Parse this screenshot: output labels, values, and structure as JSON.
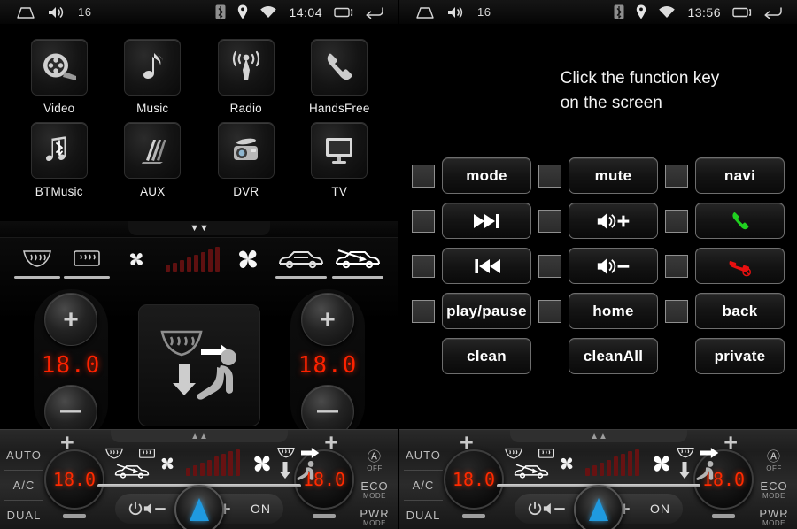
{
  "left": {
    "statusbar": {
      "home_icon": "home-icon",
      "volume_icon": "volume-icon",
      "volume_value": "16",
      "bluetooth_icon": "bluetooth-icon",
      "location_icon": "location-pin-icon",
      "wifi_icon": "wifi-icon",
      "time": "14:04",
      "recents_icon": "recents-icon",
      "back_icon": "back-arrow-icon"
    },
    "apps": [
      {
        "label": "Video",
        "icon": "film-reel-icon"
      },
      {
        "label": "Music",
        "icon": "music-note-icon"
      },
      {
        "label": "Radio",
        "icon": "radio-antenna-icon"
      },
      {
        "label": "HandsFree",
        "icon": "phone-handset-icon"
      },
      {
        "label": "BTMusic",
        "icon": "bluetooth-music-icon"
      },
      {
        "label": "AUX",
        "icon": "aux-lines-icon"
      },
      {
        "label": "DVR",
        "icon": "dashcam-icon"
      },
      {
        "label": "TV",
        "icon": "tv-monitor-icon"
      }
    ],
    "pull_tab_icon": "chevron-down-icon",
    "climate": {
      "top_icons": [
        {
          "name": "front-defrost-icon",
          "underline": true
        },
        {
          "name": "rear-defrost-icon",
          "underline": true
        },
        {
          "name": "fan-small-icon",
          "underline": false
        },
        {
          "name": "fan-speed-bars-icon",
          "underline": false
        },
        {
          "name": "fan-large-icon",
          "underline": false
        },
        {
          "name": "recirculate-air-icon",
          "underline": true
        },
        {
          "name": "fresh-air-icon",
          "underline": true
        }
      ],
      "fan_bar_heights": [
        8,
        10,
        13,
        16,
        19,
        22,
        25,
        28
      ],
      "left_temp": "18.0",
      "right_temp": "18.0",
      "plus_label": "+",
      "minus_label": "—",
      "vent_icons": [
        "front-defrost-icon",
        "arrow-right-icon",
        "arrow-down-icon",
        "seat-icon"
      ]
    }
  },
  "right": {
    "statusbar": {
      "home_icon": "home-icon",
      "volume_icon": "volume-icon",
      "volume_value": "16",
      "bluetooth_icon": "bluetooth-icon",
      "location_icon": "location-pin-icon",
      "wifi_icon": "wifi-icon",
      "time": "13:56",
      "recents_icon": "recents-icon",
      "back_icon": "back-arrow-icon"
    },
    "hint_line1": "Click the function key",
    "hint_line2": "on the screen",
    "keyrows": [
      [
        {
          "label": "mode",
          "icon": null,
          "checkbox": true
        },
        {
          "label": "mute",
          "icon": null,
          "checkbox": true
        },
        {
          "label": "navi",
          "icon": null,
          "checkbox": true
        }
      ],
      [
        {
          "label": "",
          "icon": "next-track-icon",
          "checkbox": true
        },
        {
          "label": "",
          "icon": "volume-up-icon",
          "checkbox": true
        },
        {
          "label": "",
          "icon": "call-answer-icon",
          "checkbox": true
        }
      ],
      [
        {
          "label": "",
          "icon": "previous-track-icon",
          "checkbox": true
        },
        {
          "label": "",
          "icon": "volume-down-icon",
          "checkbox": true
        },
        {
          "label": "",
          "icon": "call-end-icon",
          "checkbox": true
        }
      ],
      [
        {
          "label": "play/pause",
          "icon": null,
          "checkbox": true
        },
        {
          "label": "home",
          "icon": null,
          "checkbox": true
        },
        {
          "label": "back",
          "icon": null,
          "checkbox": true
        }
      ],
      [
        {
          "label": "clean",
          "icon": null,
          "checkbox": false
        },
        {
          "label": "cleanAll",
          "icon": null,
          "checkbox": false
        },
        {
          "label": "private",
          "icon": null,
          "checkbox": false
        }
      ]
    ]
  },
  "hwbar": {
    "left_keys": [
      {
        "main": "AUTO",
        "sub": ""
      },
      {
        "main": "A/C",
        "sub": ""
      },
      {
        "main": "DUAL",
        "sub": ""
      }
    ],
    "right_keys": [
      {
        "main": "Ⓐ",
        "sub": "OFF"
      },
      {
        "main": "ECO",
        "sub": "MODE"
      },
      {
        "main": "PWR",
        "sub": "MODE"
      }
    ],
    "left_temp": "18.0",
    "right_temp": "18.0",
    "plus_label": "+",
    "center_icons": [
      "front-defrost-icon",
      "rear-defrost-icon",
      "recirculate-air-icon",
      "fan-small-icon",
      "fan-speed-bars-icon",
      "fan-large-icon",
      "front-defrost-icon",
      "arrow-right-icon",
      "arrow-down-icon",
      "seat-icon"
    ],
    "media": {
      "power_icon": "power-icon",
      "vol_down_icon": "volume-minus-icon",
      "joystick_icon": "joystick-icon",
      "vol_up_icon": "volume-plus-icon",
      "on_label": "ON"
    },
    "notch_icon": "chevron-up-icon",
    "fan_bar_heights": [
      9,
      12,
      15,
      18,
      22,
      25,
      28,
      30
    ]
  },
  "colors": {
    "temp_red": "#ff2200",
    "accent_blue": "#1f9ae0",
    "call_green": "#20d020",
    "call_red": "#e81010"
  }
}
